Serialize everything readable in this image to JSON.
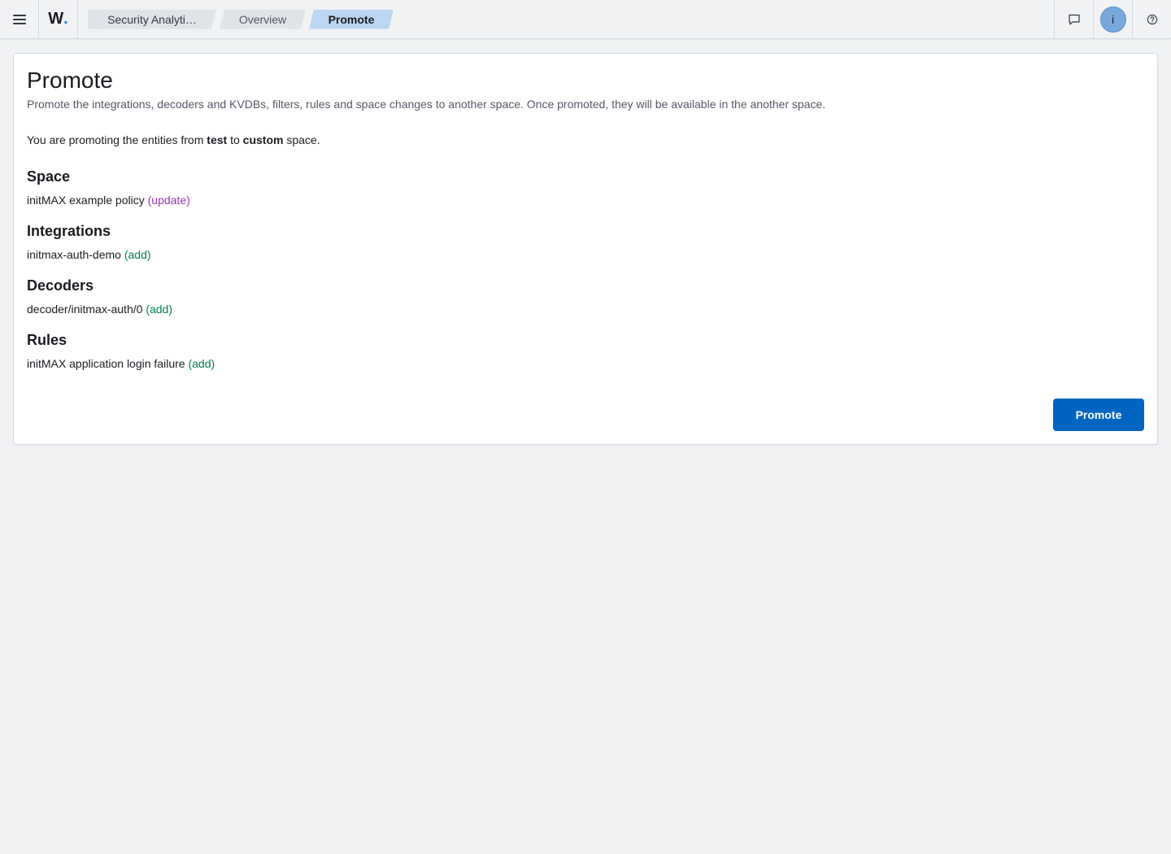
{
  "header": {
    "logo_text": "W",
    "logo_dot": ".",
    "breadcrumbs": [
      {
        "label": "Security Analyti…"
      },
      {
        "label": "Overview"
      },
      {
        "label": "Promote"
      }
    ],
    "avatar_initial": "i"
  },
  "page": {
    "title": "Promote",
    "description": "Promote the integrations, decoders and KVDBs, filters, rules and space changes to another space. Once promoted, they will be available in the another space.",
    "promote_prefix": "You are promoting the entities from ",
    "from_space": "test",
    "promote_middle": " to ",
    "to_space": "custom",
    "promote_suffix": " space."
  },
  "sections": [
    {
      "title": "Space",
      "item": "initMAX example policy",
      "tag": "(update)"
    },
    {
      "title": "Integrations",
      "item": "initmax-auth-demo",
      "tag": "(add)"
    },
    {
      "title": "Decoders",
      "item": "decoder/initmax-auth/0",
      "tag": "(add)"
    },
    {
      "title": "Rules",
      "item": "initMAX application login failure",
      "tag": "(add)"
    }
  ],
  "actions": {
    "promote_label": "Promote"
  },
  "colors": {
    "accent": "#0065c1",
    "update_tag": "#9b35b3",
    "add_tag": "#007e5a",
    "active_crumb": "#b9d6f2"
  }
}
